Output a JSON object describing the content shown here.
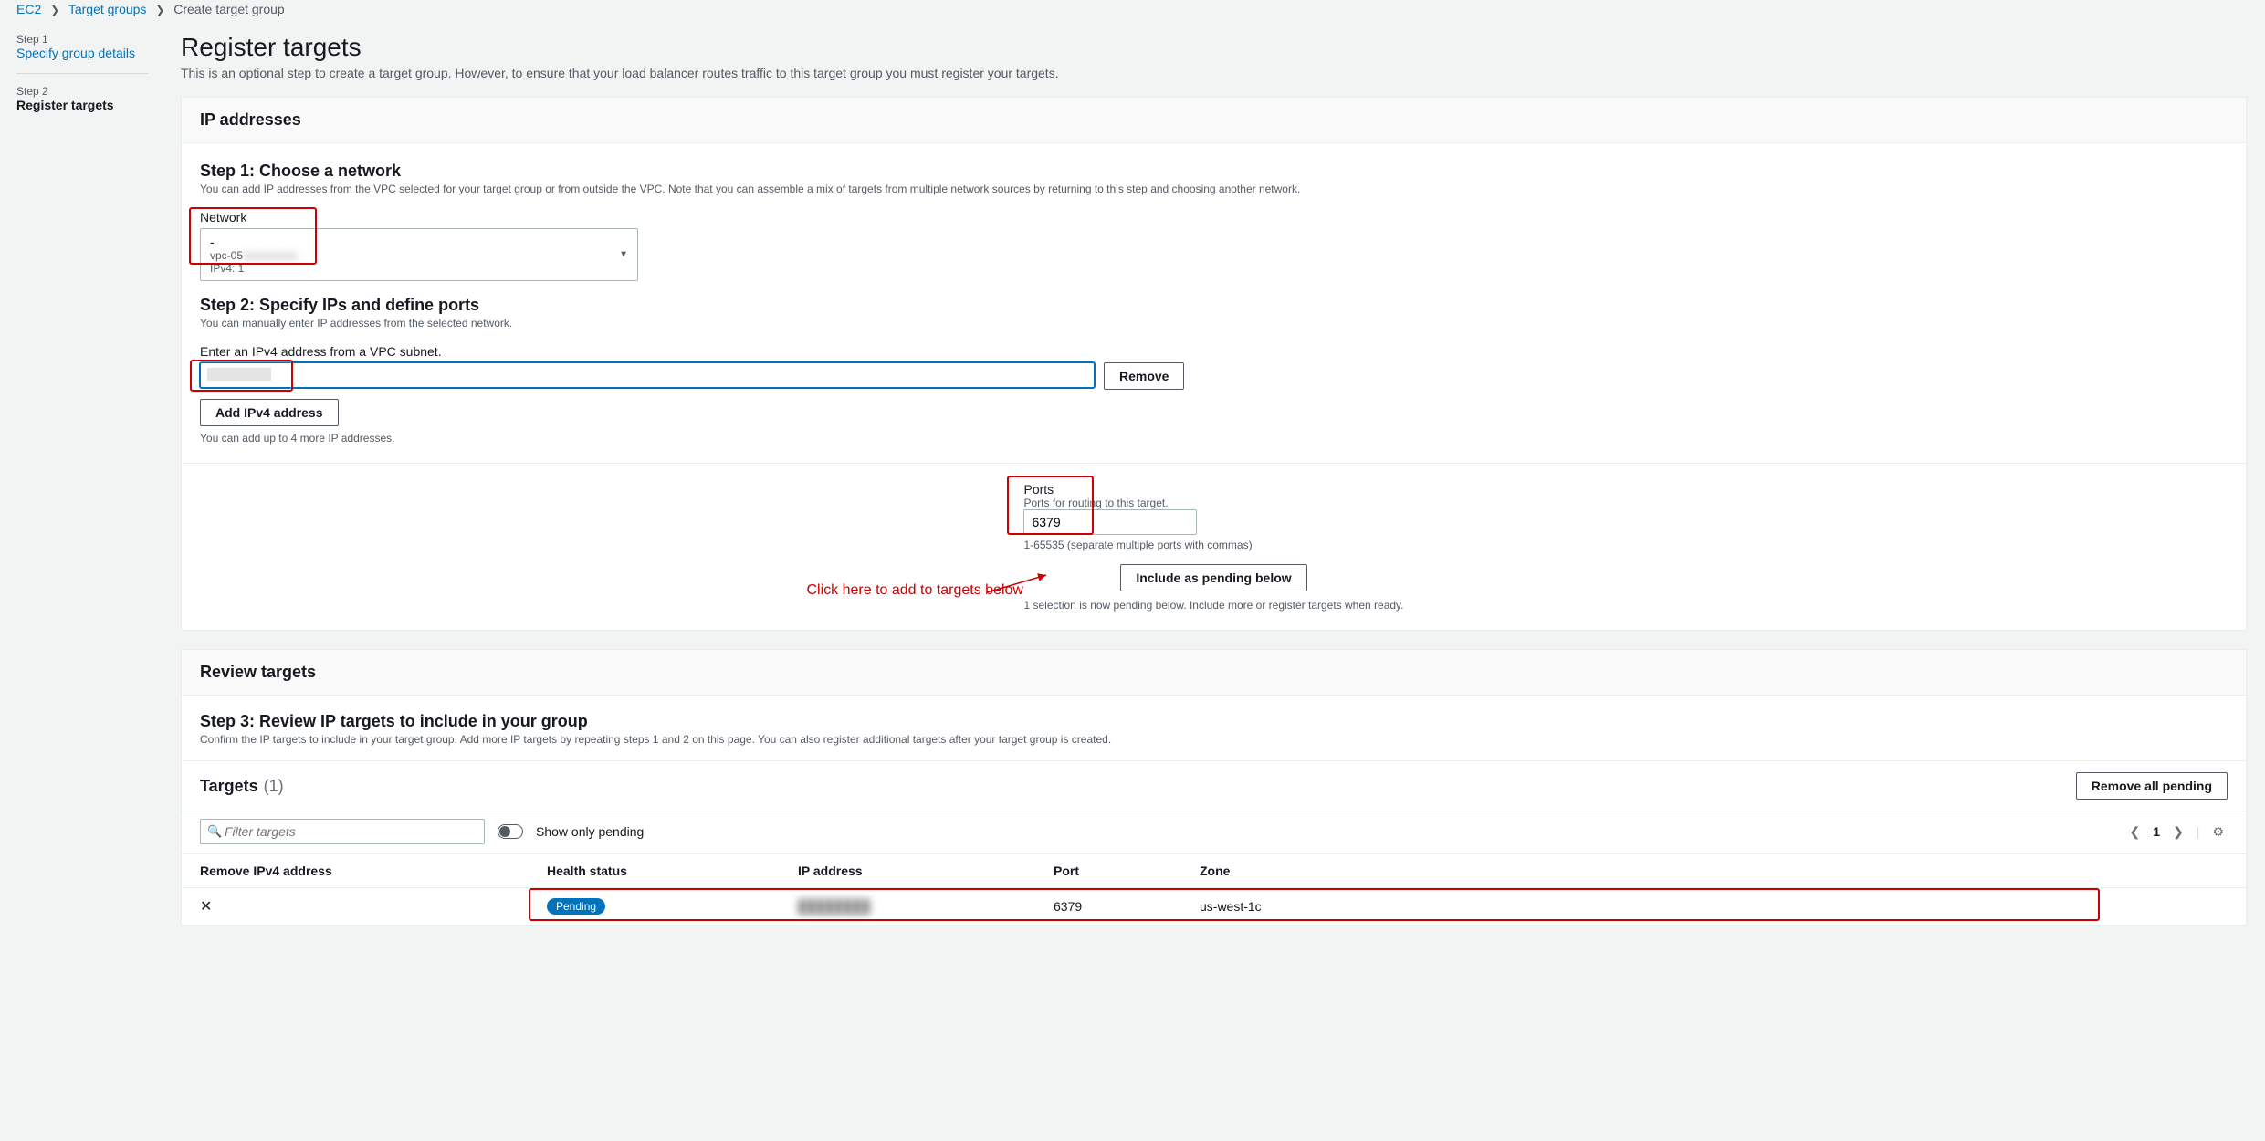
{
  "breadcrumbs": {
    "ec2": "EC2",
    "target_groups": "Target groups",
    "current": "Create target group"
  },
  "wizard": {
    "step1_label": "Step 1",
    "step1_title": "Specify group details",
    "step2_label": "Step 2",
    "step2_title": "Register targets"
  },
  "page_title": "Register targets",
  "page_subtitle": "This is an optional step to create a target group. However, to ensure that your load balancer routes traffic to this target group you must register your targets.",
  "ip_panel": {
    "header": "IP addresses",
    "step1_title": "Step 1: Choose a network",
    "step1_help": "You can add IP addresses from the VPC selected for your target group or from outside the VPC. Note that you can assemble a mix of targets from multiple network sources by returning to this step and choosing another network.",
    "network_label": "Network",
    "network_line1": "-",
    "network_line2": "vpc-05",
    "network_line3": "IPv4: 1",
    "step2_title": "Step 2: Specify IPs and define ports",
    "step2_help": "You can manually enter IP addresses from the selected network.",
    "ip_label": "Enter an IPv4 address from a VPC subnet.",
    "ip_value": "",
    "remove_btn": "Remove",
    "add_ip_btn": "Add IPv4 address",
    "add_ip_help": "You can add up to 4 more IP addresses.",
    "ports_title": "Ports",
    "ports_help": "Ports for routing to this target.",
    "ports_value": "6379",
    "ports_range": "1-65535 (separate multiple ports with commas)",
    "include_btn": "Include as pending below",
    "include_help": "1 selection is now pending below. Include more or register targets when ready."
  },
  "annotation_text": "Click here to add to targets below",
  "review_panel": {
    "header": "Review targets",
    "step3_title": "Step 3: Review IP targets to include in your group",
    "step3_help": "Confirm the IP targets to include in your target group. Add more IP targets by repeating steps 1 and 2 on this page. You can also register additional targets after your target group is created.",
    "targets_title": "Targets",
    "targets_count": "(1)",
    "remove_all_btn": "Remove all pending",
    "filter_placeholder": "Filter targets",
    "show_pending": "Show only pending",
    "page_num": "1",
    "cols": {
      "remove": "Remove IPv4 address",
      "health": "Health status",
      "ip": "IP address",
      "port": "Port",
      "zone": "Zone"
    },
    "row": {
      "health": "Pending",
      "ip": "████████",
      "port": "6379",
      "zone": "us-west-1c"
    }
  }
}
